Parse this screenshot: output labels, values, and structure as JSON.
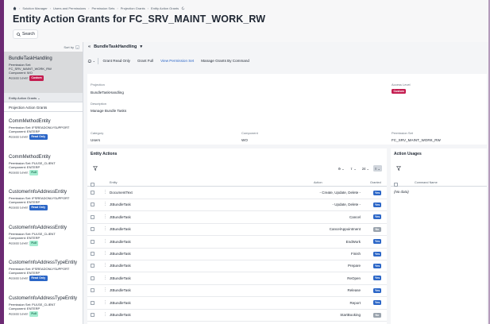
{
  "breadcrumb": [
    "Solution Manager",
    "Users and Permissions",
    "Permission Sets",
    "Projection Grants",
    "Entity Action Grants"
  ],
  "page_title": "Entity Action Grants for FC_SRV_MAINT_WORK_RW",
  "search_label": "Search",
  "sidebar": {
    "sort_label": "Sort by",
    "selected": {
      "title": "BundleTaskHandling",
      "permission_set": "Permission Set:",
      "permission_set_value": "FC_SRV_MAINT_WORK_RW",
      "component": "Component:",
      "component_value": "WO",
      "access_level": "Access Level:",
      "badge": "Custom"
    },
    "tab_label": "Entity Action Grants",
    "nav_label": "Projection Action Grants",
    "cards": [
      {
        "title": "CommMethodEntity",
        "permission_set": "IFSREADONLYSUPPORT",
        "component": "ENTERP",
        "badge": "Read Only",
        "type": "ro"
      },
      {
        "title": "CommMethodEntity",
        "permission_set": "PULSE_CLIENT",
        "component": "ENTERP",
        "badge": "Full",
        "type": "full"
      },
      {
        "title": "CustomerInfoAddressEntity",
        "permission_set": "IFSREADONLYSUPPORT",
        "component": "ENTERP",
        "badge": "Read Only",
        "type": "ro"
      },
      {
        "title": "CustomerInfoAddressEntity",
        "permission_set": "PULSE_CLIENT",
        "component": "ENTERP",
        "badge": "Full",
        "type": "full"
      },
      {
        "title": "CustomerInfoAddressTypeEntity",
        "permission_set": "IFSREADONLYSUPPORT",
        "component": "ENTERP",
        "badge": "Read Only",
        "type": "ro"
      },
      {
        "title": "CustomerInfoAddressTypeEntity",
        "permission_set": "PULSE_CLIENT",
        "component": "ENTERP",
        "badge": "Full",
        "type": "full"
      }
    ],
    "labels": {
      "permission_set": "Permission Set:",
      "component": "Component:",
      "access_level": "Access Level:"
    }
  },
  "main": {
    "header": "BundleTaskHandling",
    "toolbar": [
      "Grant Read Only",
      "Grant Full",
      "View Permission Set",
      "Manage Grants By Command"
    ],
    "info": {
      "projection_label": "Projection",
      "projection_value": "BundleTaskHandling",
      "description_label": "Description",
      "description_value": "Manage Bundle Tasks",
      "access_level_label": "Access Level",
      "access_level_badge": "Custom",
      "category_label": "Category",
      "category_value": "Users",
      "component_label": "Component",
      "component_value": "WO",
      "permission_set_label": "Permission Set",
      "permission_set_value": "FC_SRV_MAINT_WORK_RW"
    },
    "entity_actions": {
      "title": "Entity Actions",
      "page_size": "24",
      "columns": [
        "Entity",
        "Action",
        "Granted"
      ],
      "rows": [
        {
          "entity": "DocumentText",
          "action": "- Create, Update, Delete -",
          "granted": "Yes"
        },
        {
          "entity": "JtBundleTask",
          "action": "- Update, Delete -",
          "granted": "Yes"
        },
        {
          "entity": "JtBundleTask",
          "action": "Cancel",
          "granted": "Yes"
        },
        {
          "entity": "JtBundleTask",
          "action": "CancelAppointment",
          "granted": "No"
        },
        {
          "entity": "JtBundleTask",
          "action": "EndWork",
          "granted": "Yes"
        },
        {
          "entity": "JtBundleTask",
          "action": "Finish",
          "granted": "Yes"
        },
        {
          "entity": "JtBundleTask",
          "action": "Prepare",
          "granted": "Yes"
        },
        {
          "entity": "JtBundleTask",
          "action": "ReOpen",
          "granted": "Yes"
        },
        {
          "entity": "JtBundleTask",
          "action": "Release",
          "granted": "Yes"
        },
        {
          "entity": "JtBundleTask",
          "action": "Report",
          "granted": "Yes"
        },
        {
          "entity": "JtBundleTask",
          "action": "StartBooking",
          "granted": "No"
        }
      ]
    },
    "action_usages": {
      "title": "Action Usages",
      "column": "Command Name",
      "empty": "(No data)"
    }
  }
}
